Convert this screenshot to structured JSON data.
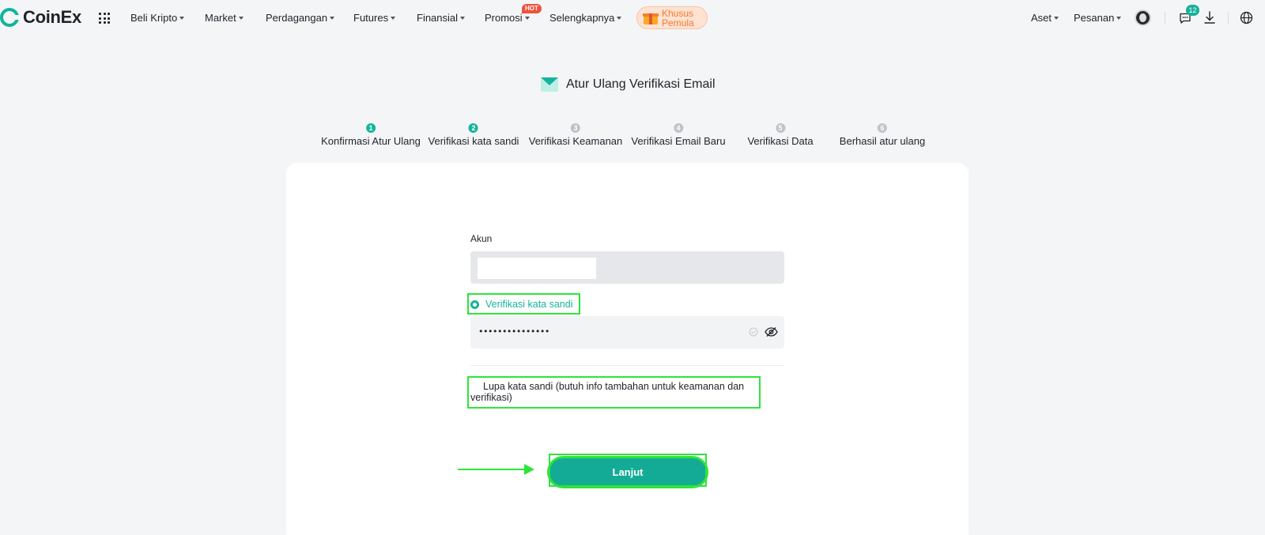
{
  "brand": {
    "name": "CoinEx",
    "accent": "#15b49c"
  },
  "nav": {
    "items": [
      {
        "label": "Beli Kripto"
      },
      {
        "label": "Market"
      },
      {
        "label": "Perdagangan"
      },
      {
        "label": "Futures"
      },
      {
        "label": "Finansial"
      },
      {
        "label": "Promosi"
      },
      {
        "label": "Selengkapnya"
      }
    ],
    "hot_badge": "HOT",
    "promo_line1": "Khusus",
    "promo_line2": "Pemula",
    "right": {
      "assets": "Aset",
      "orders": "Pesanan",
      "message_count": "12"
    },
    "icons": [
      "apps-grid-icon",
      "gift-icon",
      "avatar",
      "chat-icon",
      "download-icon",
      "globe-icon"
    ]
  },
  "page": {
    "title": "Atur Ulang Verifikasi Email",
    "steps": [
      {
        "num": "1",
        "label": "Konfirmasi Atur Ulang",
        "state": "done"
      },
      {
        "num": "2",
        "label": "Verifikasi kata sandi",
        "state": "active"
      },
      {
        "num": "3",
        "label": "Verifikasi Keamanan",
        "state": "pending"
      },
      {
        "num": "4",
        "label": "Verifikasi Email Baru",
        "state": "pending"
      },
      {
        "num": "5",
        "label": "Verifikasi Data",
        "state": "pending"
      },
      {
        "num": "6",
        "label": "Berhasil atur ulang",
        "state": "pending"
      }
    ]
  },
  "form": {
    "account_label": "Akun",
    "account_value": "",
    "option_password": "Verifikasi kata sandi",
    "password_value": "•••••••••••••••",
    "option_forgot": "Lupa kata sandi (butuh info tambahan untuk keamanan dan verifikasi)",
    "submit_label": "Lanjut"
  }
}
